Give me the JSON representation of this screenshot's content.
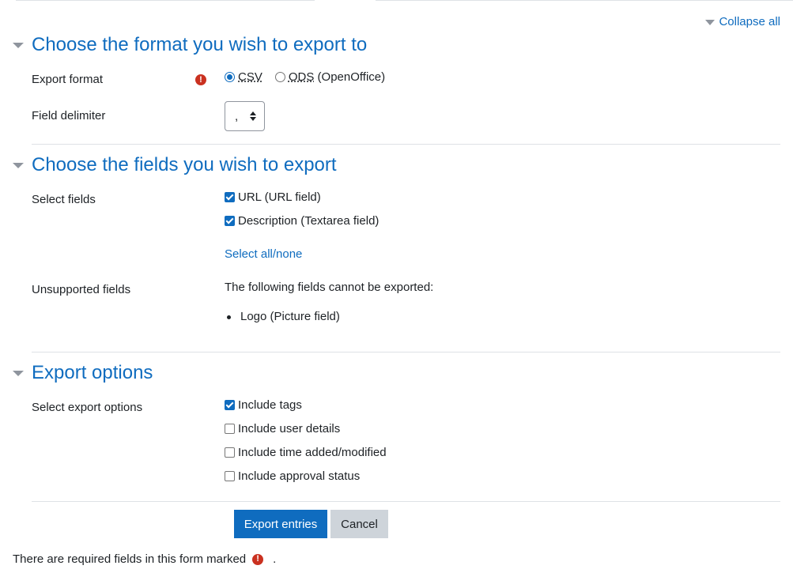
{
  "header": {
    "collapse_all": "Collapse all"
  },
  "sections": {
    "format": {
      "title": "Choose the format you wish to export to"
    },
    "fields": {
      "title": "Choose the fields you wish to export"
    },
    "options": {
      "title": "Export options"
    }
  },
  "export_format": {
    "label": "Export format",
    "required_icon": "exclamation-circle-icon",
    "csv_label": "CSV",
    "ods_label": "ODS",
    "ods_suffix": " (OpenOffice)",
    "selected": "CSV"
  },
  "field_delimiter": {
    "label": "Field delimiter",
    "value": ","
  },
  "select_fields": {
    "label": "Select fields",
    "items": [
      {
        "label": "URL (URL field)",
        "checked": true
      },
      {
        "label": "Description (Textarea field)",
        "checked": true
      }
    ],
    "select_all_link": "Select all/none"
  },
  "unsupported_fields": {
    "label": "Unsupported fields",
    "message": "The following fields cannot be exported:",
    "items": [
      "Logo (Picture field)"
    ]
  },
  "export_options": {
    "label": "Select export options",
    "items": [
      {
        "label": "Include tags",
        "checked": true
      },
      {
        "label": "Include user details",
        "checked": false
      },
      {
        "label": "Include time added/modified",
        "checked": false
      },
      {
        "label": "Include approval status",
        "checked": false
      }
    ]
  },
  "buttons": {
    "export": "Export entries",
    "cancel": "Cancel"
  },
  "footer": {
    "required_note": "There are required fields in this form marked",
    "required_note_end": "."
  },
  "colors": {
    "accent": "#0f6cbf",
    "required": "#ca3120",
    "secondary_button": "#ced4da"
  }
}
